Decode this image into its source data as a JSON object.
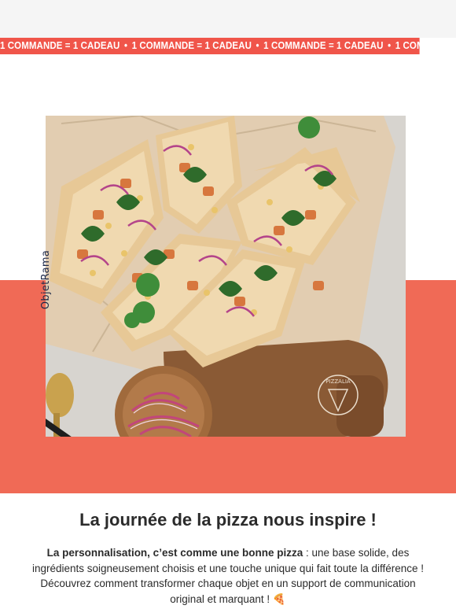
{
  "ticker": {
    "text": "1 COMMANDE = 1 CADEAU",
    "separator": "•",
    "repeat": 4,
    "background": "#f0554a"
  },
  "hero": {
    "image_icon": "pizza-flatbread-photo",
    "brand_watermark": "ObjetRama",
    "board_stamp": "PIZZALIA"
  },
  "band_color": "#f06a56",
  "article": {
    "title": "La journée de la pizza nous inspire !",
    "lead_bold": "La personnalisation, c’est comme une bonne pizza",
    "lead_rest": " : une base solide, des ingrédients soigneusement choisis et une touche unique qui fait toute la différence ! Découvrez comment transformer chaque objet en un support de communication original et marquant ! ",
    "emoji": "🍕"
  }
}
